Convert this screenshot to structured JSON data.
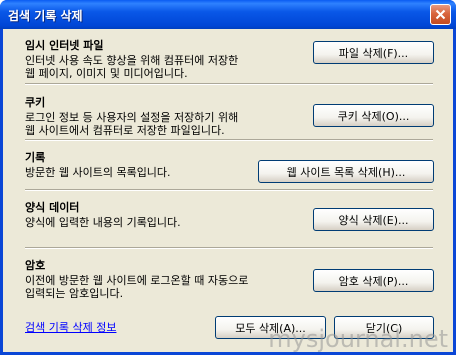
{
  "window": {
    "title": "검색 기록 삭제",
    "close_label": "×"
  },
  "sections": [
    {
      "title": "임시 인터넷 파일",
      "desc_line1": "인터넷 사용 속도 향상을 위해 컴퓨터에 저장한",
      "desc_line2": "웹 페이지, 이미지 및 미디어입니다.",
      "button": "파일 삭제(F)..."
    },
    {
      "title": "쿠키",
      "desc_line1": "로그인 정보 등 사용자의 설정을 저장하기 위해",
      "desc_line2": "웹 사이트에서 컴퓨터로 저장한 파일입니다.",
      "button": "쿠키 삭제(O)..."
    },
    {
      "title": "기록",
      "desc_line1": "방문한 웹 사이트의 목록입니다.",
      "button": "웹 사이트 목록 삭제(H)..."
    },
    {
      "title": "양식 데이터",
      "desc_line1": "양식에 입력한 내용의 기록입니다.",
      "button": "양식 삭제(E)..."
    },
    {
      "title": "암호",
      "desc_line1": "이전에 방문한 웹 사이트에 로그온할 때 자동으로",
      "desc_line2": "입력되는 암호입니다.",
      "button": "암호 삭제(P)..."
    }
  ],
  "footer": {
    "info_link": "검색 기록 삭제 정보",
    "delete_all_button": "모두 삭제(A)...",
    "close_button": "닫기(C)"
  },
  "watermark": "mysjournal.net"
}
